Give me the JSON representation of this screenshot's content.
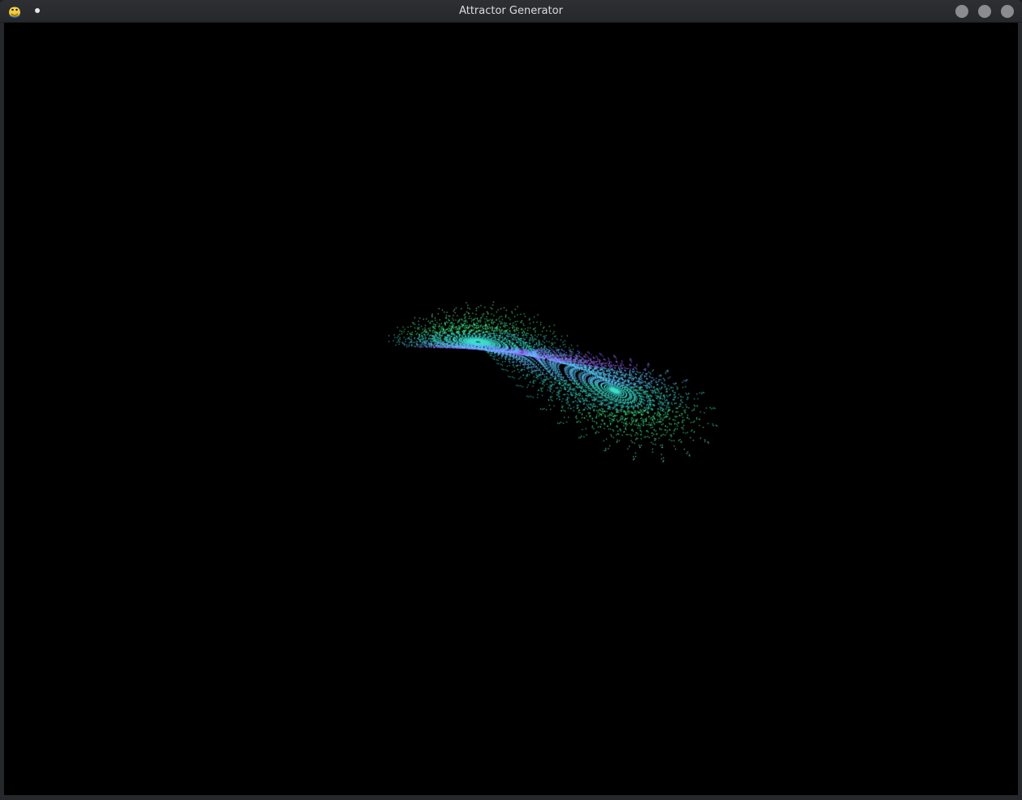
{
  "window": {
    "title": "Attractor Generator"
  },
  "titlebar": {
    "app_icon": "python-snake-icon",
    "pin_icon": "dot-icon",
    "buttons": [
      {
        "name": "minimize-button",
        "icon": "circle-icon"
      },
      {
        "name": "maximize-button",
        "icon": "circle-icon"
      },
      {
        "name": "close-button",
        "icon": "circle-icon"
      }
    ]
  },
  "canvas": {
    "background": "#000000",
    "attractor": "lorenz",
    "palette": [
      "#7b5cff",
      "#9a6bff",
      "#5ec8ff",
      "#3fe0d0",
      "#4dff9a",
      "#7dffb0"
    ]
  },
  "colors": {
    "titlebar": "#2b2d31",
    "button": "#8a8c90",
    "title_text": "#dcdcdc"
  }
}
